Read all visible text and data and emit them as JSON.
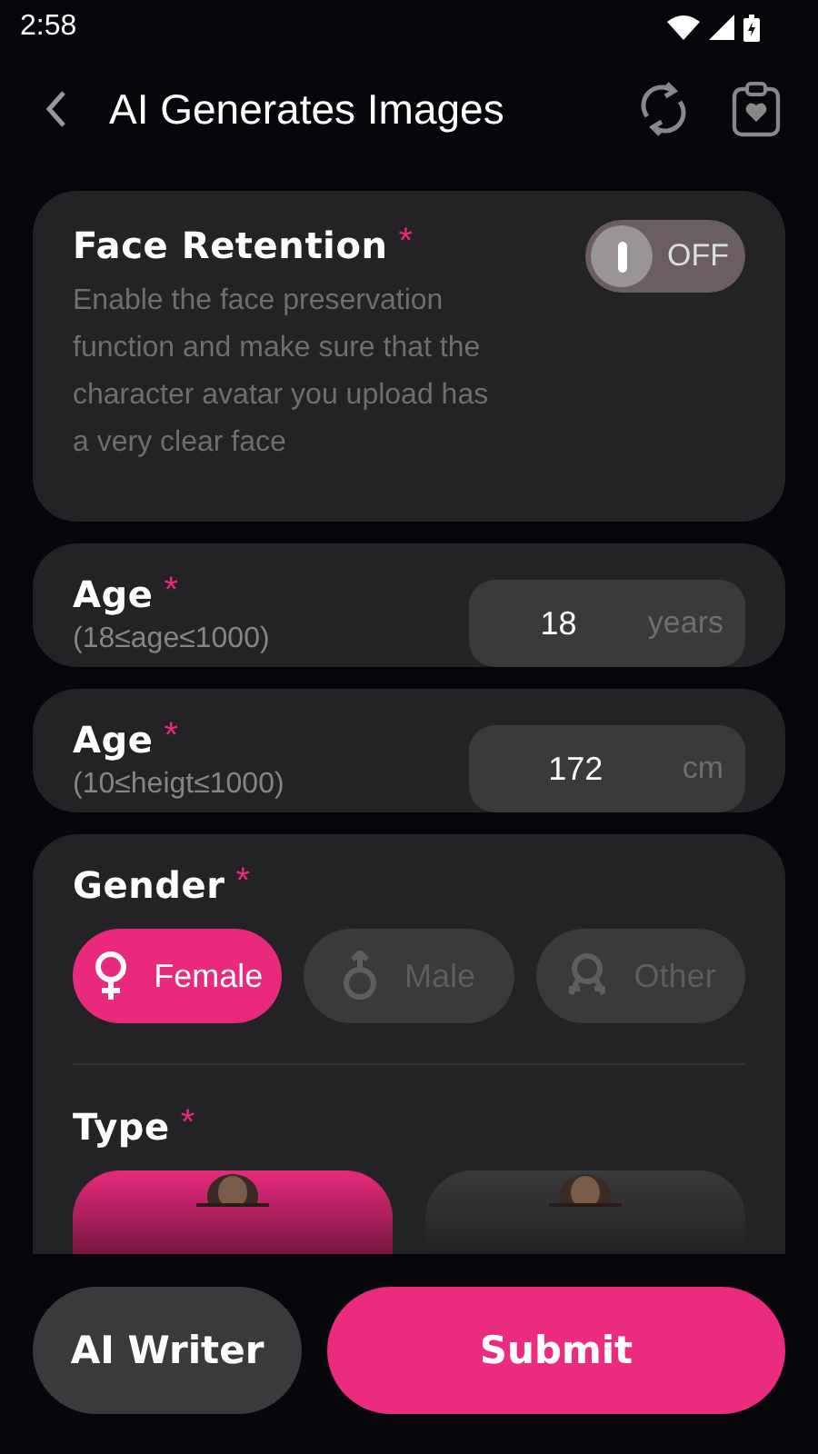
{
  "status_bar": {
    "time": "2:58"
  },
  "header": {
    "title": "AI Generates Images"
  },
  "face_retention": {
    "title": "Face Retention",
    "mark": "*",
    "description": "Enable the face preservation function and make sure that the character avatar you upload has a very clear face",
    "toggle": {
      "on": false,
      "label": "OFF"
    }
  },
  "fields": [
    {
      "label": "Age",
      "mark": "*",
      "hint": "(18≤age≤1000)",
      "value": "18",
      "unit": "years"
    },
    {
      "label": "Age",
      "mark": "*",
      "hint": "(10≤heigt≤1000)",
      "value": "172",
      "unit": "cm"
    }
  ],
  "gender": {
    "label": "Gender",
    "mark": "*",
    "options": [
      {
        "label": "Female",
        "kind": "female",
        "selected": true
      },
      {
        "label": "Male",
        "kind": "male",
        "selected": false
      },
      {
        "label": "Other",
        "kind": "other",
        "selected": false
      }
    ]
  },
  "type": {
    "label": "Type",
    "mark": "*",
    "options": [
      {
        "kind": "picture",
        "selected": true
      },
      {
        "kind": "picture",
        "selected": false
      }
    ]
  },
  "footer": {
    "writer_button": "AI Writer",
    "submit_button": "Submit"
  }
}
